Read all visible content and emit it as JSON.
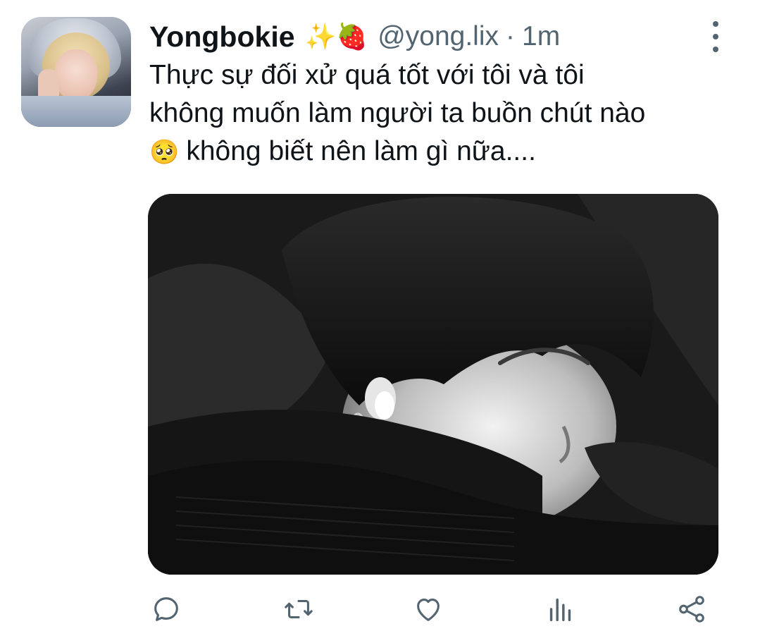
{
  "tweet": {
    "display_name": "Yongbokie",
    "name_emoji": "✨🍓",
    "handle": "@yong.lix",
    "separator": "·",
    "time": "1m",
    "text_lines": [
      "Thực sự đối xử quá tốt với tôi và tôi",
      "không muốn làm người ta buồn chút nào"
    ],
    "text_emoji": "🥺",
    "text_last_line": "không biết nên làm gì nữa...."
  },
  "actions": {
    "reply_icon": "reply-icon",
    "retweet_icon": "retweet-icon",
    "like_icon": "heart-icon",
    "analytics_icon": "analytics-icon",
    "share_icon": "share-icon"
  },
  "colors": {
    "text_primary": "#0f1419",
    "text_secondary": "#536471",
    "background": "#ffffff"
  }
}
